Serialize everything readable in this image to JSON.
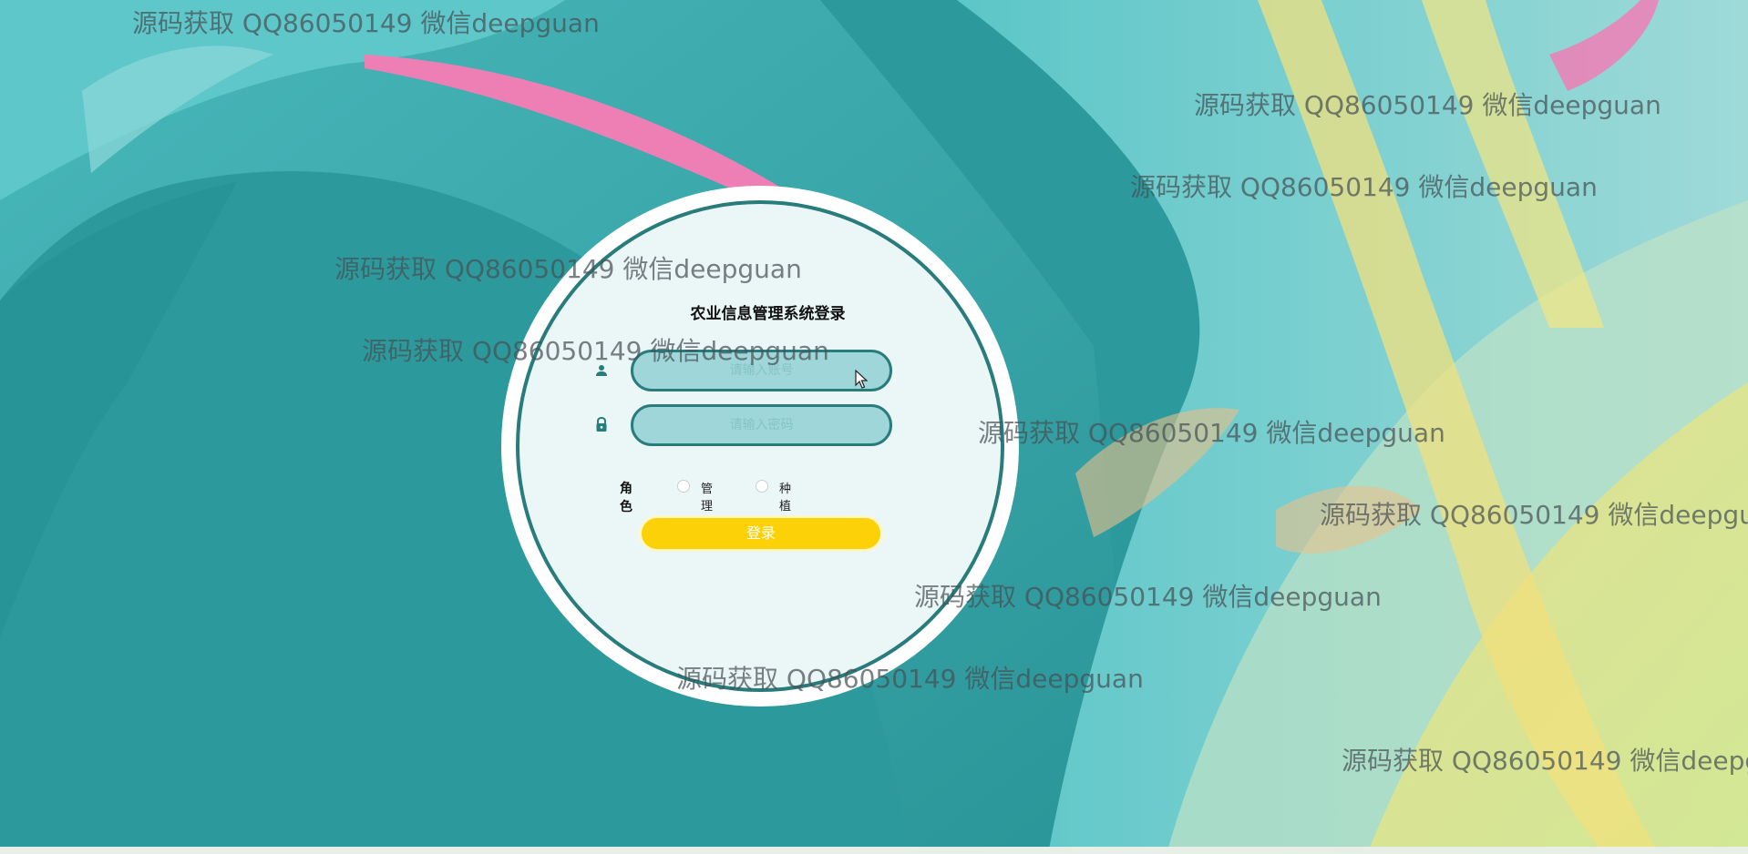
{
  "watermark_text": "源码获取 QQ86050149 微信deepguan",
  "login": {
    "title": "农业信息管理系统登录",
    "username_placeholder": "请输入账号",
    "password_placeholder": "请输入密码",
    "role_label": "角色",
    "roles": [
      "管理员",
      "种植户"
    ],
    "submit_label": "登录"
  },
  "colors": {
    "accent": "#287c7c",
    "input_fill": "#9fd6da",
    "button": "#fcd108",
    "panel": "#ebf6f6"
  },
  "icons": {
    "username": "user-icon",
    "password": "lock-icon"
  }
}
